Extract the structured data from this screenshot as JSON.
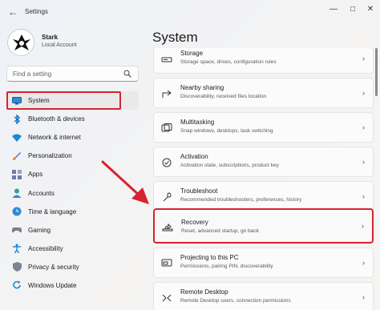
{
  "window": {
    "title": "Settings"
  },
  "account": {
    "name": "Stark",
    "type": "Local Account"
  },
  "search": {
    "placeholder": "Find a setting"
  },
  "sidebar": {
    "items": [
      {
        "label": "System",
        "icon": "monitor-icon",
        "selected": true
      },
      {
        "label": "Bluetooth & devices",
        "icon": "bluetooth-icon"
      },
      {
        "label": "Network & internet",
        "icon": "wifi-icon"
      },
      {
        "label": "Personalization",
        "icon": "brush-icon"
      },
      {
        "label": "Apps",
        "icon": "apps-icon"
      },
      {
        "label": "Accounts",
        "icon": "person-icon"
      },
      {
        "label": "Time & language",
        "icon": "globe-clock-icon"
      },
      {
        "label": "Gaming",
        "icon": "gamepad-icon"
      },
      {
        "label": "Accessibility",
        "icon": "accessibility-icon"
      },
      {
        "label": "Privacy & security",
        "icon": "shield-icon"
      },
      {
        "label": "Windows Update",
        "icon": "update-icon"
      }
    ]
  },
  "main": {
    "title": "System",
    "rows": [
      {
        "title": "Storage",
        "desc": "Storage space, drives, configuration rules",
        "icon": "storage-icon"
      },
      {
        "title": "Nearby sharing",
        "desc": "Discoverability, received files location",
        "icon": "share-icon"
      },
      {
        "title": "Multitasking",
        "desc": "Snap windows, desktops, task switching",
        "icon": "multitask-icon"
      },
      {
        "title": "Activation",
        "desc": "Activation state, subscriptions, product key",
        "icon": "check-circle-icon"
      },
      {
        "title": "Troubleshoot",
        "desc": "Recommended troubleshooters, preferences, history",
        "icon": "wrench-icon"
      },
      {
        "title": "Recovery",
        "desc": "Reset, advanced startup, go back",
        "icon": "recovery-icon",
        "highlighted": true
      },
      {
        "title": "Projecting to this PC",
        "desc": "Permissions, pairing PIN, discoverability",
        "icon": "project-icon"
      },
      {
        "title": "Remote Desktop",
        "desc": "Remote Desktop users, connection permissions",
        "icon": "remote-desktop-icon"
      }
    ]
  },
  "colors": {
    "accent": "#0063b1",
    "annotation": "#d7232e"
  }
}
